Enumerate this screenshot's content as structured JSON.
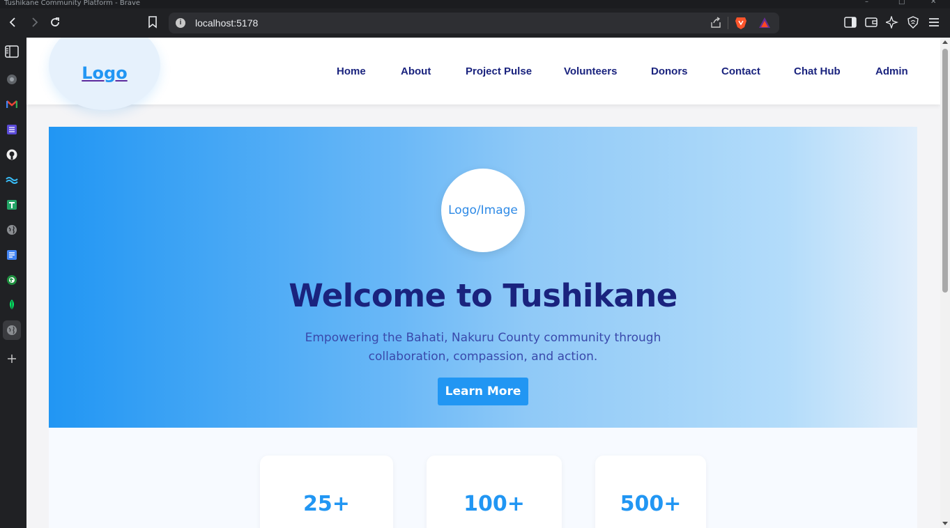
{
  "window": {
    "title": "Tushikane Community Platform - Brave"
  },
  "browser": {
    "url": "localhost:5178",
    "icons": [
      "back-icon",
      "forward-icon",
      "reload-icon",
      "bookmark-icon",
      "info-icon",
      "share-icon",
      "brave-shields-icon",
      "brave-rewards-icon",
      "sidebar-toggle-icon",
      "wallet-icon",
      "leo-ai-icon",
      "vpn-icon",
      "menu-icon"
    ]
  },
  "sidebar": {
    "items": [
      "reading-list-icon",
      "brave-icon",
      "gmail-icon",
      "tasks-icon",
      "github-icon",
      "tailwind-icon",
      "sheets-icon",
      "globe-icon",
      "docs-icon",
      "extension-icon",
      "mongodb-icon",
      "globe-icon",
      "add-icon"
    ]
  },
  "nav": {
    "logo": "Logo",
    "links": [
      "Home",
      "About",
      "Project Pulse",
      "Volunteers",
      "Donors",
      "Contact",
      "Chat Hub",
      "Admin"
    ]
  },
  "hero": {
    "image_placeholder": "Logo/Image",
    "title": "Welcome to Tushikane",
    "subtitle": "Empowering the Bahati, Nakuru County community through collaboration, compassion, and action.",
    "button": "Learn More"
  },
  "stats": {
    "values": [
      "25+",
      "100+",
      "500+"
    ]
  },
  "colors": {
    "primary": "#2196f3",
    "navy": "#1a237e",
    "subtitle": "#3949ab",
    "logo_bg": "#e6f1fc"
  }
}
